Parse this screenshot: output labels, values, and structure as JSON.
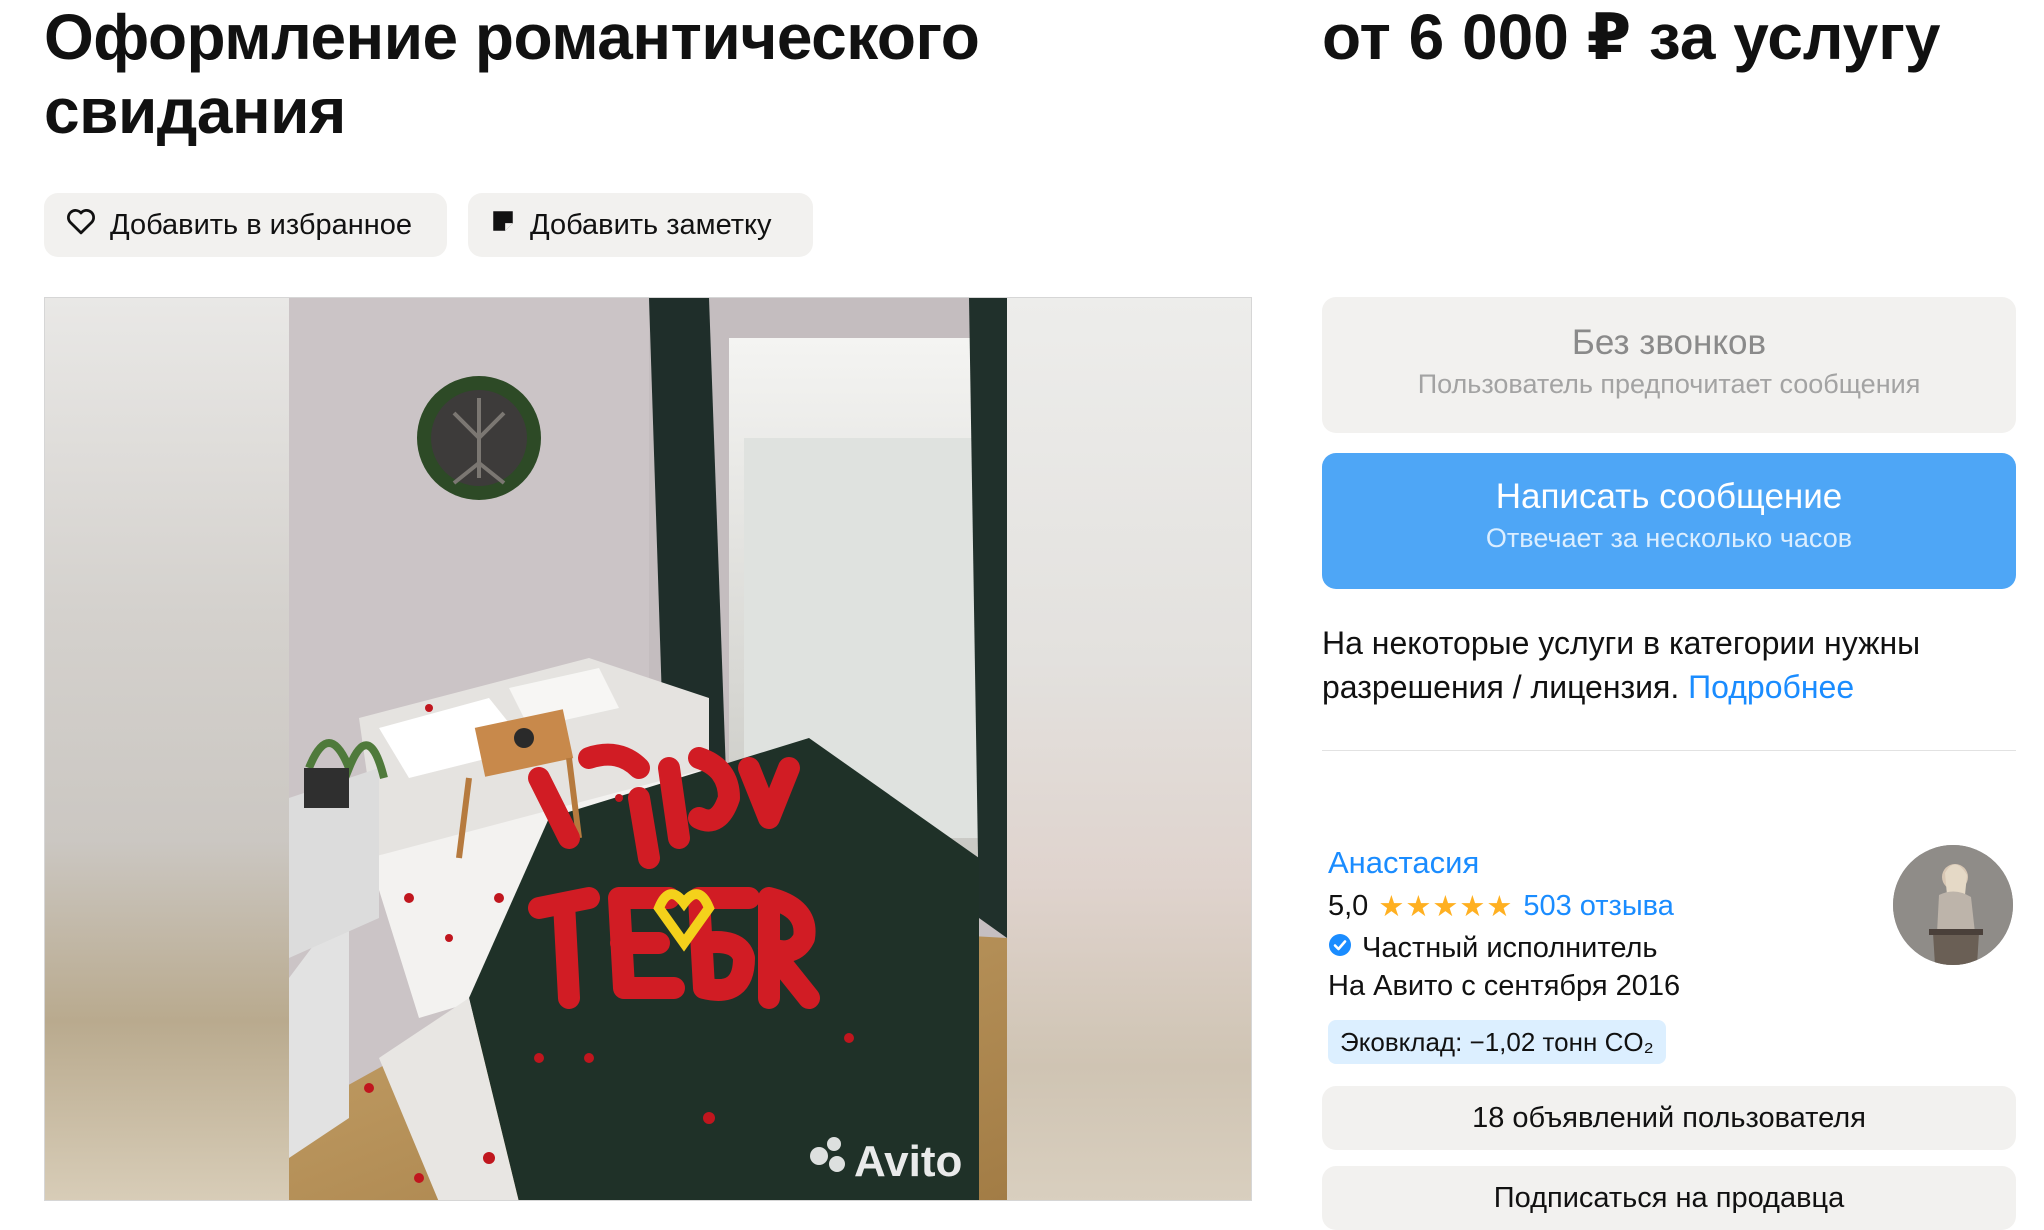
{
  "listing": {
    "title": "Оформление романтического свидания",
    "price": "от 6 000 ₽ за услугу"
  },
  "actions": {
    "favorite_label": "Добавить в избранное",
    "note_label": "Добавить заметку"
  },
  "gallery": {
    "watermark": "Avito",
    "balloon_line1": "Я ЛЮБЛЮ",
    "balloon_line2": "ТЕБЯ"
  },
  "contact": {
    "no_calls_title": "Без звонков",
    "no_calls_subtitle": "Пользователь предпочитает сообщения",
    "message_title": "Написать сообщение",
    "message_subtitle": "Отвечает за несколько часов"
  },
  "license": {
    "text": "На некоторые услуги в категории нужны разрешения / лицензия.",
    "link": "Подробнее"
  },
  "seller": {
    "name": "Анастасия",
    "rating": "5,0",
    "stars": "★★★★★",
    "reviews": "503 отзыва",
    "type": "Частный исполнитель",
    "since": "На Авито с сентября 2016",
    "eco": "Эковклад: −1,02 тонн CO₂"
  },
  "buttons": {
    "ads": "18 объявлений пользователя",
    "subscribe": "Подписаться на продавца"
  },
  "colors": {
    "accent": "#4ea6f6",
    "link": "#1a8cff",
    "star": "#ffb021",
    "button_bg": "#f2f1ef",
    "eco_bg": "#dcefff"
  },
  "icons": {
    "favorite": "heart-icon",
    "note": "note-icon",
    "verified": "verified-badge-icon"
  }
}
